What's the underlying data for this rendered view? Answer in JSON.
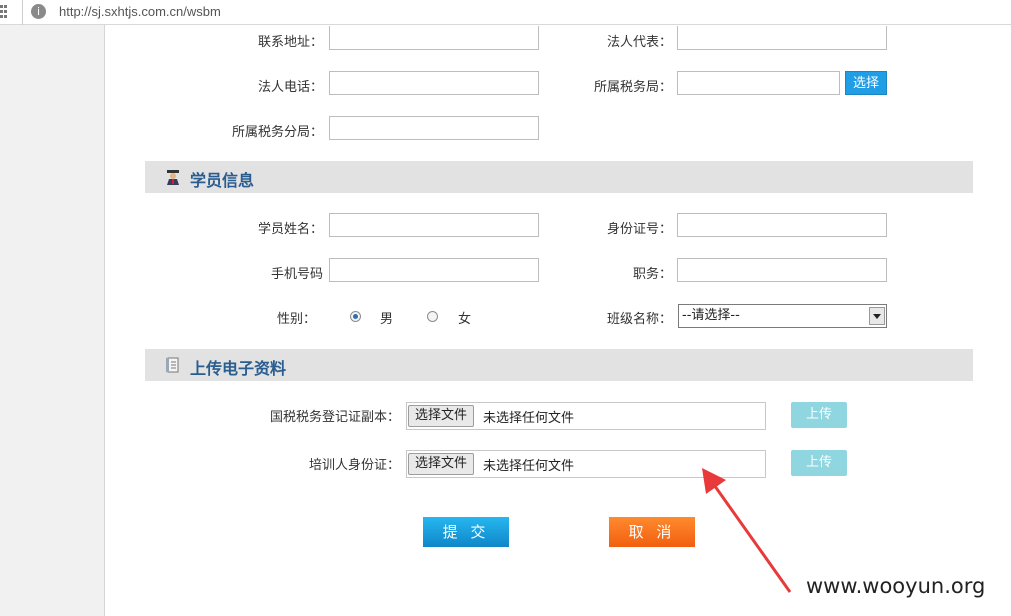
{
  "browser": {
    "url": "http://sj.sxhtjs.com.cn/wsbm"
  },
  "company": {
    "contact_address_label": "联系地址：",
    "legal_rep_label": "法人代表：",
    "legal_phone_label": "法人电话：",
    "tax_bureau_label": "所属税务局：",
    "select_button": "选择",
    "tax_sub_bureau_label": "所属税务分局："
  },
  "student_section": {
    "title": "学员信息"
  },
  "student": {
    "name_label": "学员姓名：",
    "id_label": "身份证号：",
    "mobile_label": "手机号码",
    "position_label": "职务：",
    "gender_label": "性别：",
    "gender_male": "男",
    "gender_female": "女",
    "gender_selected": "男",
    "class_label": "班级名称：",
    "class_selected": "--请选择--"
  },
  "upload_section": {
    "title": "上传电子资料"
  },
  "uploads": [
    {
      "label": "国税税务登记证副本：",
      "choose": "选择文件",
      "status": "未选择任何文件",
      "button": "上传"
    },
    {
      "label": "培训人身份证：",
      "choose": "选择文件",
      "status": "未选择任何文件",
      "button": "上传"
    }
  ],
  "actions": {
    "submit": "提 交",
    "cancel": "取 消"
  },
  "watermark": "www.wooyun.org",
  "colors": {
    "accent": "#1f9ee6",
    "submit": "#1597d8",
    "cancel": "#f86d1a",
    "upload": "#8fd6e0",
    "arrow": "#e83a3a"
  }
}
